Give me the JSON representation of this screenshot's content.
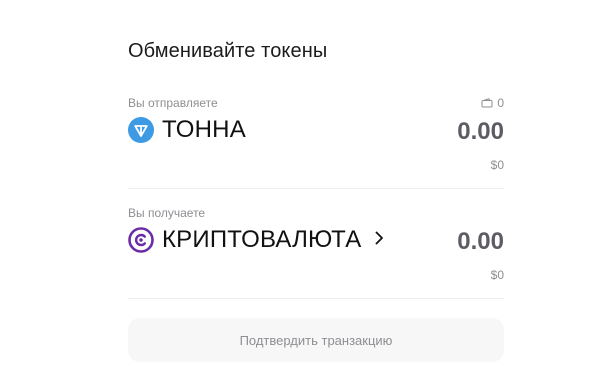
{
  "swap": {
    "title": "Обменивайте токены",
    "send": {
      "label": "Вы отправляете",
      "balance": "0",
      "token_name": "ТОННА",
      "token_icon": "ton-diamond-icon",
      "token_color": "#3d9ae3",
      "amount": "0.00",
      "usd": "$0"
    },
    "receive": {
      "label": "Вы получаете",
      "token_name": "КРИПТОВАЛЮТА",
      "token_icon": "crypto-c-icon",
      "token_color": "#6a2ca8",
      "amount": "0.00",
      "usd": "$0"
    },
    "confirm_label": "Подтвердить транзакцию"
  }
}
